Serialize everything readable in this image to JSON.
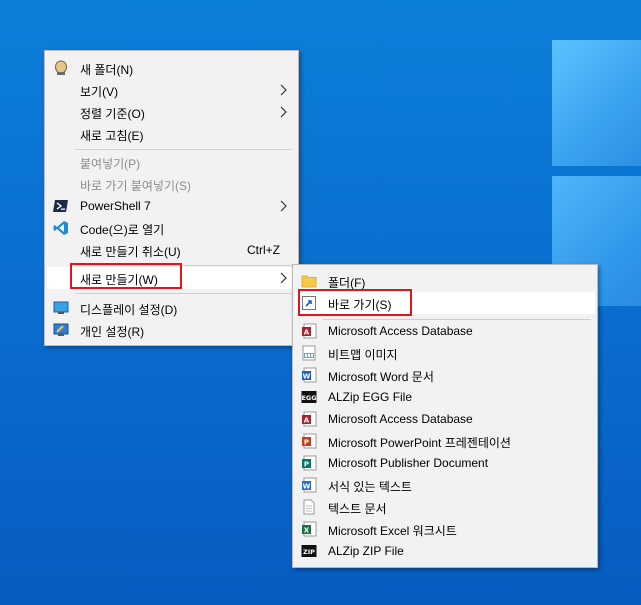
{
  "context_menu": {
    "items": [
      {
        "label": "새 폴더(N)"
      },
      {
        "label": "보기(V)"
      },
      {
        "label": "정렬 기준(O)"
      },
      {
        "label": "새로 고침(E)"
      },
      {
        "label": "붙여넣기(P)"
      },
      {
        "label": "바로 가기 붙여넣기(S)"
      },
      {
        "label": "PowerShell 7"
      },
      {
        "label": "Code(으)로 열기"
      },
      {
        "label": "새로 만들기 취소(U)",
        "shortcut": "Ctrl+Z"
      },
      {
        "label": "새로 만들기(W)"
      },
      {
        "label": "디스플레이 설정(D)"
      },
      {
        "label": "개인 설정(R)"
      }
    ]
  },
  "new_submenu": {
    "items": [
      {
        "label": "폴더(F)"
      },
      {
        "label": "바로 가기(S)"
      },
      {
        "label": "Microsoft Access Database"
      },
      {
        "label": "비트맵 이미지"
      },
      {
        "label": "Microsoft Word 문서"
      },
      {
        "label": "ALZip EGG File"
      },
      {
        "label": "Microsoft Access Database"
      },
      {
        "label": "Microsoft PowerPoint 프레젠테이션"
      },
      {
        "label": "Microsoft Publisher Document"
      },
      {
        "label": "서식 있는 텍스트"
      },
      {
        "label": "텍스트 문서"
      },
      {
        "label": "Microsoft Excel 워크시트"
      },
      {
        "label": "ALZip ZIP File"
      }
    ]
  },
  "icons": {
    "egg_badge": "EGG",
    "zip_badge": "ZIP"
  },
  "colors": {
    "highlight_box": "#e2141c",
    "desktop": "#0a6fd0"
  }
}
